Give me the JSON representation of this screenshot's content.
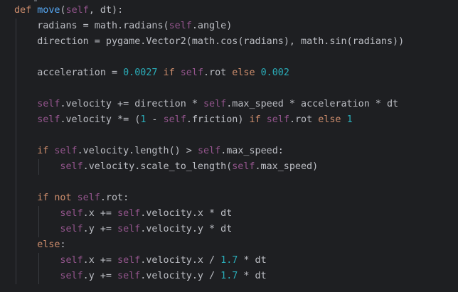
{
  "theme": {
    "background": "#1e1f22",
    "text": "#bcbec4",
    "keyword": "#cf8e6d",
    "self": "#94558d",
    "function": "#56a8f5",
    "number": "#2aacb8",
    "indent_guide": "#393b40"
  },
  "code": {
    "lines": [
      {
        "indent": 0,
        "tokens": [
          {
            "t": "kw",
            "v": "def "
          },
          {
            "t": "fn",
            "v": "move"
          },
          {
            "t": "id",
            "v": "("
          },
          {
            "t": "self",
            "v": "self"
          },
          {
            "t": "id",
            "v": ", dt):"
          }
        ]
      },
      {
        "indent": 1,
        "tokens": [
          {
            "t": "id",
            "v": "radians = math.radians("
          },
          {
            "t": "self",
            "v": "self"
          },
          {
            "t": "id",
            "v": ".angle)"
          }
        ]
      },
      {
        "indent": 1,
        "tokens": [
          {
            "t": "id",
            "v": "direction = pygame.Vector2(math.cos(radians), math.sin(radians))"
          }
        ]
      },
      {
        "indent": 0,
        "tokens": []
      },
      {
        "indent": 1,
        "tokens": [
          {
            "t": "id",
            "v": "acceleration = "
          },
          {
            "t": "num",
            "v": "0.0027"
          },
          {
            "t": "kw",
            "v": " if "
          },
          {
            "t": "self",
            "v": "self"
          },
          {
            "t": "id",
            "v": ".rot"
          },
          {
            "t": "kw",
            "v": " else "
          },
          {
            "t": "num",
            "v": "0.002"
          }
        ]
      },
      {
        "indent": 0,
        "tokens": []
      },
      {
        "indent": 1,
        "tokens": [
          {
            "t": "self",
            "v": "self"
          },
          {
            "t": "id",
            "v": ".velocity += direction * "
          },
          {
            "t": "self",
            "v": "self"
          },
          {
            "t": "id",
            "v": ".max_speed * acceleration * dt"
          }
        ]
      },
      {
        "indent": 1,
        "tokens": [
          {
            "t": "self",
            "v": "self"
          },
          {
            "t": "id",
            "v": ".velocity *= ("
          },
          {
            "t": "num",
            "v": "1"
          },
          {
            "t": "id",
            "v": " - "
          },
          {
            "t": "self",
            "v": "self"
          },
          {
            "t": "id",
            "v": ".friction)"
          },
          {
            "t": "kw",
            "v": " if "
          },
          {
            "t": "self",
            "v": "self"
          },
          {
            "t": "id",
            "v": ".rot"
          },
          {
            "t": "kw",
            "v": " else "
          },
          {
            "t": "num",
            "v": "1"
          }
        ]
      },
      {
        "indent": 0,
        "tokens": []
      },
      {
        "indent": 1,
        "tokens": [
          {
            "t": "kw",
            "v": "if "
          },
          {
            "t": "self",
            "v": "self"
          },
          {
            "t": "id",
            "v": ".velocity.length() > "
          },
          {
            "t": "self",
            "v": "self"
          },
          {
            "t": "id",
            "v": ".max_speed:"
          }
        ]
      },
      {
        "indent": 2,
        "tokens": [
          {
            "t": "self",
            "v": "self"
          },
          {
            "t": "id",
            "v": ".velocity.scale_to_length("
          },
          {
            "t": "self",
            "v": "self"
          },
          {
            "t": "id",
            "v": ".max_speed)"
          }
        ]
      },
      {
        "indent": 0,
        "tokens": []
      },
      {
        "indent": 1,
        "tokens": [
          {
            "t": "kw",
            "v": "if not "
          },
          {
            "t": "self",
            "v": "self"
          },
          {
            "t": "id",
            "v": ".rot:"
          }
        ]
      },
      {
        "indent": 2,
        "tokens": [
          {
            "t": "self",
            "v": "self"
          },
          {
            "t": "id",
            "v": ".x += "
          },
          {
            "t": "self",
            "v": "self"
          },
          {
            "t": "id",
            "v": ".velocity.x * dt"
          }
        ]
      },
      {
        "indent": 2,
        "tokens": [
          {
            "t": "self",
            "v": "self"
          },
          {
            "t": "id",
            "v": ".y += "
          },
          {
            "t": "self",
            "v": "self"
          },
          {
            "t": "id",
            "v": ".velocity.y * dt"
          }
        ]
      },
      {
        "indent": 1,
        "tokens": [
          {
            "t": "kw",
            "v": "else"
          },
          {
            "t": "id",
            "v": ":"
          }
        ]
      },
      {
        "indent": 2,
        "tokens": [
          {
            "t": "self",
            "v": "self"
          },
          {
            "t": "id",
            "v": ".x += "
          },
          {
            "t": "self",
            "v": "self"
          },
          {
            "t": "id",
            "v": ".velocity.x / "
          },
          {
            "t": "num",
            "v": "1.7"
          },
          {
            "t": "id",
            "v": " * dt"
          }
        ]
      },
      {
        "indent": 2,
        "tokens": [
          {
            "t": "self",
            "v": "self"
          },
          {
            "t": "id",
            "v": ".y += "
          },
          {
            "t": "self",
            "v": "self"
          },
          {
            "t": "id",
            "v": ".velocity.y / "
          },
          {
            "t": "num",
            "v": "1.7"
          },
          {
            "t": "id",
            "v": " * dt"
          }
        ]
      }
    ]
  }
}
